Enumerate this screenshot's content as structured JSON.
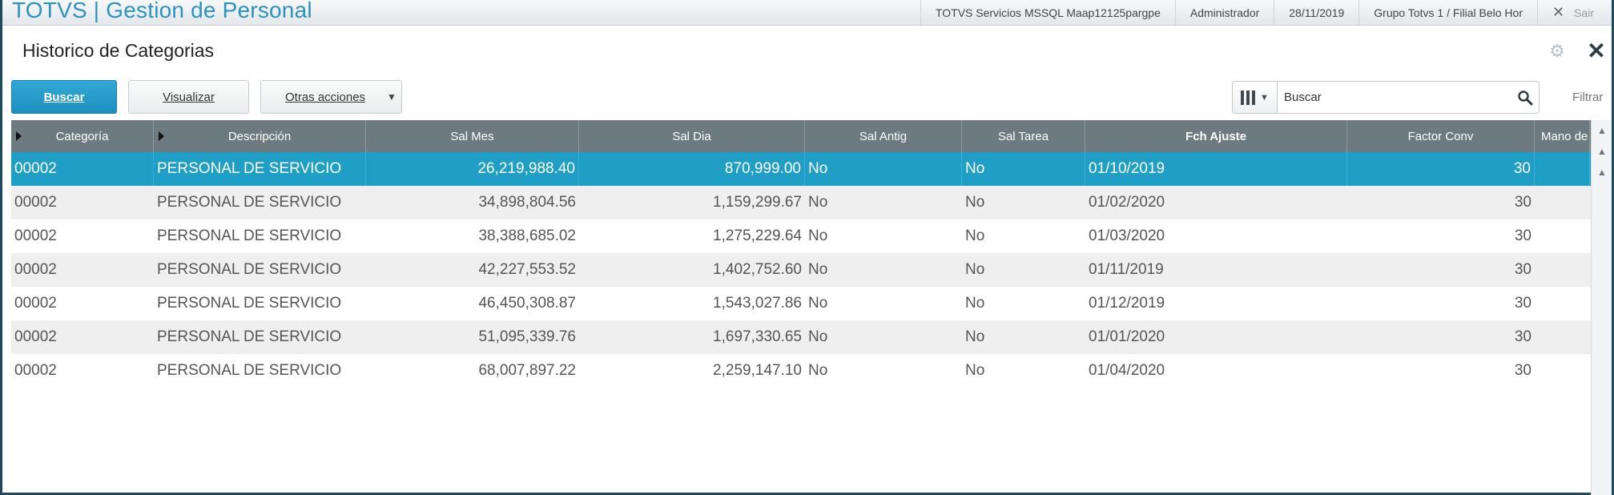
{
  "header": {
    "brand": "TOTVS | Gestion de Personal",
    "environment": "TOTVS Servicios MSSQL Maap12125pargpe",
    "user": "Administrador",
    "date": "28/11/2019",
    "branch": "Grupo Totvs 1 / Filial Belo Hor",
    "exit_label": "Sair"
  },
  "dialog": {
    "title": "Historico de Categorias"
  },
  "toolbar": {
    "buscar": "Buscar",
    "visualizar": "Visualizar",
    "otras": "Otras acciones",
    "search_value": "Buscar",
    "filtrar": "Filtrar"
  },
  "grid": {
    "columns": [
      "Categoría",
      "Descripción",
      "Sal Mes",
      "Sal Dia",
      "Sal  Antig",
      "Sal Tarea",
      "Fch Ajuste",
      "Factor Conv",
      "Mano de o"
    ],
    "rows": [
      [
        "00002",
        "PERSONAL DE SERVICIO",
        "26,219,988.40",
        "870,999.00",
        "No",
        "No",
        "01/10/2019",
        "30",
        ""
      ],
      [
        "00002",
        "PERSONAL DE SERVICIO",
        "34,898,804.56",
        "1,159,299.67",
        "No",
        "No",
        "01/02/2020",
        "30",
        ""
      ],
      [
        "00002",
        "PERSONAL DE SERVICIO",
        "38,388,685.02",
        "1,275,229.64",
        "No",
        "No",
        "01/03/2020",
        "30",
        ""
      ],
      [
        "00002",
        "PERSONAL DE SERVICIO",
        "42,227,553.52",
        "1,402,752.60",
        "No",
        "No",
        "01/11/2019",
        "30",
        ""
      ],
      [
        "00002",
        "PERSONAL DE SERVICIO",
        "46,450,308.87",
        "1,543,027.86",
        "No",
        "No",
        "01/12/2019",
        "30",
        ""
      ],
      [
        "00002",
        "PERSONAL DE SERVICIO",
        "51,095,339.76",
        "1,697,330.65",
        "No",
        "No",
        "01/01/2020",
        "30",
        ""
      ],
      [
        "00002",
        "PERSONAL DE SERVICIO",
        "68,007,897.22",
        "2,259,147.10",
        "No",
        "No",
        "01/04/2020",
        "30",
        ""
      ]
    ],
    "selected_row": 0
  },
  "colors": {
    "brand": "#2b93c0",
    "primary_button": "#1d8fbe",
    "selected_row": "#1f9fc5",
    "header_bg": "#6d7a80"
  }
}
